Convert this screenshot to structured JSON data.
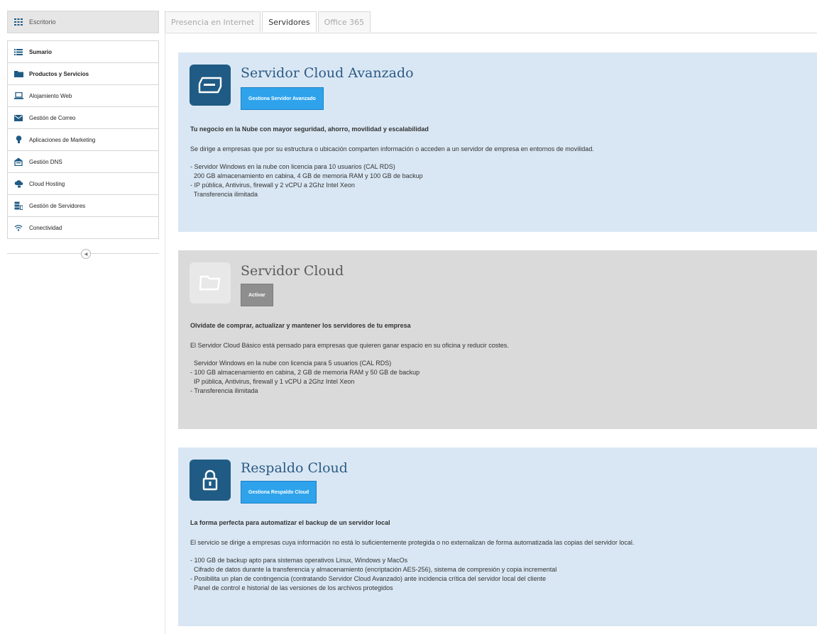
{
  "sidebar": {
    "top_label": "Escritorio",
    "items": [
      {
        "label": "Sumario",
        "icon": "list-icon",
        "bold": true
      },
      {
        "label": "Productos y Servicios",
        "icon": "folder-icon",
        "bold": true
      },
      {
        "label": "Alojamiento Web",
        "icon": "laptop-icon",
        "bold": false
      },
      {
        "label": "Gestión de Correo",
        "icon": "mail-icon",
        "bold": false
      },
      {
        "label": "Aplicaciones de Marketing",
        "icon": "lightbulb-icon",
        "bold": false
      },
      {
        "label": "Gestión DNS",
        "icon": "network-icon",
        "bold": false
      },
      {
        "label": "Cloud Hosting",
        "icon": "cloud-icon",
        "bold": false
      },
      {
        "label": "Gestión de Servidores",
        "icon": "server-icon",
        "bold": false
      },
      {
        "label": "Conectividad",
        "icon": "wifi-icon",
        "bold": false
      }
    ],
    "collapse_glyph": "◀"
  },
  "tabs": [
    {
      "label": "Presencia en Internet",
      "active": false
    },
    {
      "label": "Servidores",
      "active": true
    },
    {
      "label": "Office 365",
      "active": false
    }
  ],
  "cards": [
    {
      "title": "Servidor Cloud Avanzado",
      "button": "Gestiona Servidor Avanzado",
      "headline": "Tu negocio en la Nube con mayor seguridad, ahorro, movilidad y escalabilidad",
      "description": "Se dirige a empresas que por su estructura o ubicación comparten información o acceden a un servidor de empresa en entornos de movilidad.",
      "lines": [
        "- Servidor Windows en la nube con licencia para 10 usuarios (CAL RDS)",
        "  200 GB almacenamiento en cabina, 4 GB de memoria RAM y 100 GB de backup",
        "- IP pública, Antivirus, firewall y 2 vCPU a 2Ghz Intel Xeon",
        "  Transferencia ilimitada"
      ]
    },
    {
      "title": "Servidor Cloud",
      "button": "Activar",
      "headline": "Olvídate de comprar, actualizar y mantener los servidores de tu empresa",
      "description": "El Servidor Cloud Básico está pensado para empresas que quieren ganar espacio en su oficina y reducir costes.",
      "lines": [
        "  Servidor Windows en la nube con licencia para 5 usuarios (CAL RDS)",
        "- 100 GB almacenamiento en cabina, 2 GB de memoria RAM y 50 GB de backup",
        "  IP pública, Antivirus, firewall y 1 vCPU a 2Ghz Intel Xeon",
        "- Transferencia ilimitada"
      ]
    },
    {
      "title": "Respaldo Cloud",
      "button": "Gestiona Respaldo Cloud",
      "headline": "La forma perfecta para automatizar el backup de un servidor local",
      "description": "El servicio se dirige a empresas cuya información no está lo suficientemente protegida o no externalizan de forma automatizada las copias del servidor local.",
      "lines": [
        "- 100 GB de backup apto para sistemas operativos Linux, Windows y MacOs",
        "  Cifrado de datos durante la transferencia y almacenamiento (encriptación AES-256), sistema de compresión y copia incremental",
        "- Posibilita un plan de contingencia (contratando Servidor Cloud Avanzado) ante incidencia crítica del servidor local del cliente",
        "  Panel de control e historial de las versiones de los archivos protegidos"
      ]
    }
  ]
}
